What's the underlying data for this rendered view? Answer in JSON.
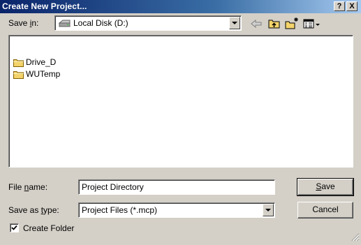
{
  "window": {
    "title": "Create New Project...",
    "help_label": "?",
    "close_label": "X"
  },
  "savein": {
    "label_prefix": "Save ",
    "label_accel": "i",
    "label_suffix": "n:",
    "value": "Local Disk (D:)"
  },
  "files": [
    {
      "name": "Drive_D",
      "icon": "folder-icon"
    },
    {
      "name": "WUTemp",
      "icon": "folder-icon"
    }
  ],
  "filename": {
    "label_prefix": "File ",
    "label_accel": "n",
    "label_suffix": "ame:",
    "value": "Project Directory"
  },
  "savetype": {
    "label_prefix": "Save as ",
    "label_accel": "t",
    "label_suffix": "ype:",
    "value": "Project Files (*.mcp)"
  },
  "buttons": {
    "save_accel": "S",
    "save_rest": "ave",
    "cancel": "Cancel"
  },
  "create_folder": {
    "label": "Create Folder",
    "checked": true
  },
  "colors": {
    "face": "#d4d0c8",
    "title_start": "#0a246a",
    "title_end": "#a6caf0",
    "folder": "#f3d36a"
  }
}
